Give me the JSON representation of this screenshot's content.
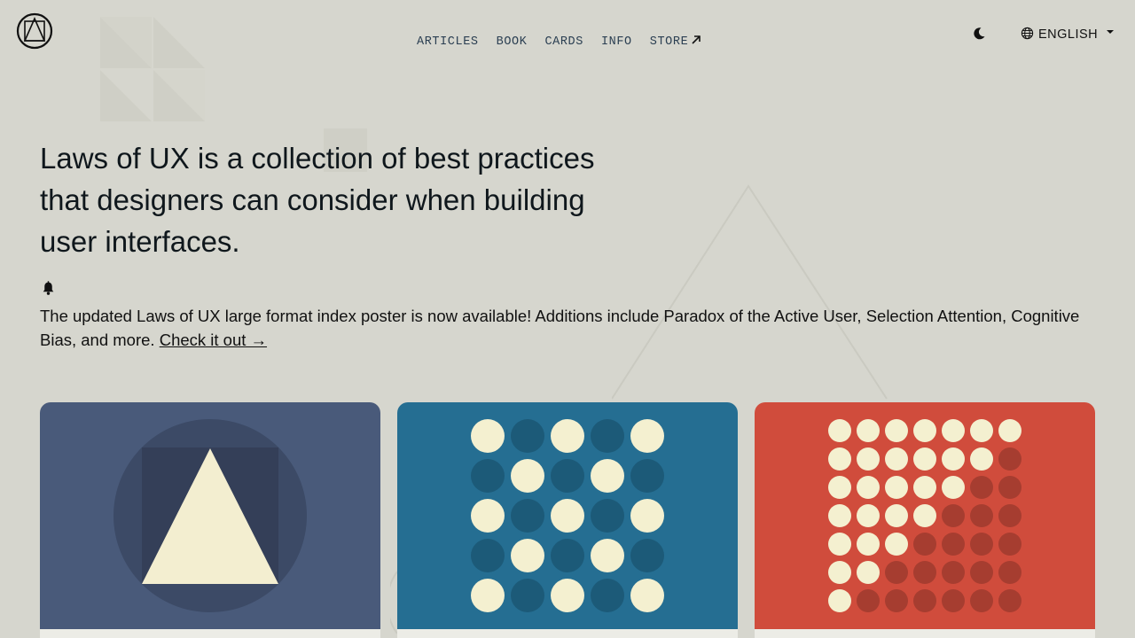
{
  "nav": {
    "items": [
      {
        "label": "ARTICLES"
      },
      {
        "label": "BOOK"
      },
      {
        "label": "CARDS"
      },
      {
        "label": "INFO"
      },
      {
        "label": "STORE",
        "external": true
      }
    ]
  },
  "header": {
    "logo_icon": "laws-of-ux-logo-icon",
    "theme_icon": "moon-icon",
    "language": {
      "label": "ENGLISH",
      "icon": "globe-icon"
    }
  },
  "hero": {
    "headline": "Laws of UX is a collection of best practices that designers can consider when building user interfaces."
  },
  "notice": {
    "icon": "bell-icon",
    "text": "The updated Laws of UX large format index poster is now available! Additions include Paradox of the Active User, Selection Attention, Cognitive Bias, and more. ",
    "link_label": "Check it out →"
  },
  "cards": [
    {
      "illustration": "triangle-in-circle-icon",
      "color": "#495a7a"
    },
    {
      "illustration": "dot-grid-5x5-icon",
      "color": "#256e92"
    },
    {
      "illustration": "dot-grid-7x7-diagonal-icon",
      "color": "#d04c3c"
    }
  ],
  "colors": {
    "background": "#d6d6ce",
    "nav_text": "#2b3f52",
    "cream": "#f4f0d0"
  }
}
